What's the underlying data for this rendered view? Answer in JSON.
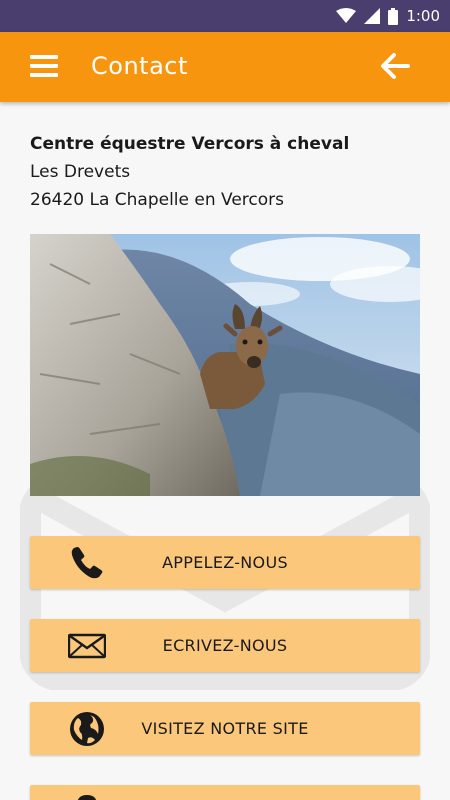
{
  "status_bar": {
    "time": "1:00",
    "icons": [
      "wifi-icon",
      "signal-icon",
      "battery-icon"
    ]
  },
  "app_bar": {
    "title": "Contact",
    "menu_icon": "menu-icon",
    "back_icon": "arrow-left-icon",
    "color": "#f7950f"
  },
  "address": {
    "name": "Centre équestre Vercors à cheval",
    "line1": "Les Drevets",
    "line2": "26420 La Chapelle en Vercors"
  },
  "photo": {
    "icon": "chamois-photo"
  },
  "buttons": [
    {
      "label": "APPELEZ-NOUS",
      "icon": "phone-icon"
    },
    {
      "label": "ECRIVEZ-NOUS",
      "icon": "envelope-icon"
    },
    {
      "label": "VISITEZ NOTRE SITE",
      "icon": "globe-icon"
    },
    {
      "label": "",
      "icon": "map-pin-icon"
    }
  ],
  "colors": {
    "status_bar": "#4a3e6e",
    "accent": "#f7950f",
    "button_bg": "#fbc77b"
  }
}
